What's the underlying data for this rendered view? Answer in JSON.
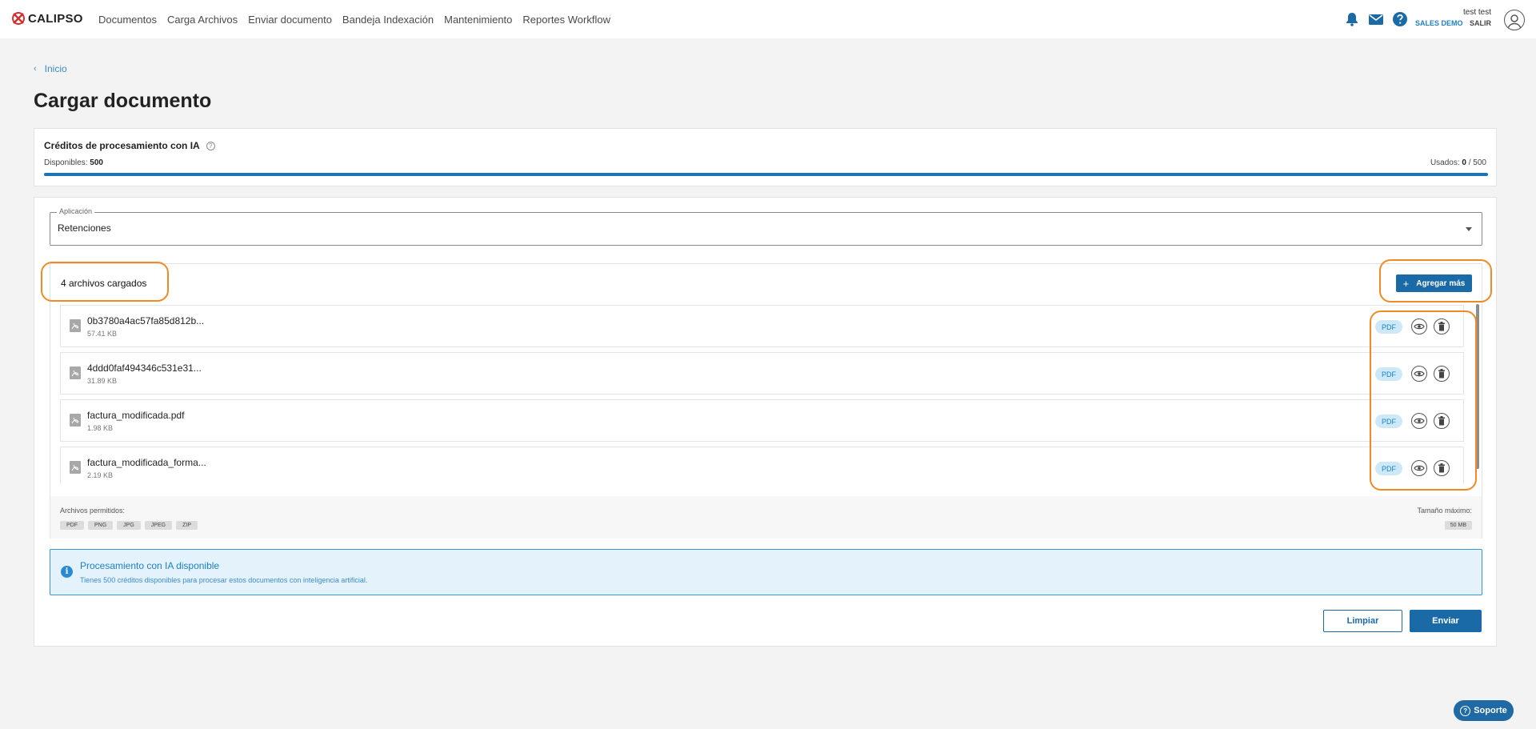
{
  "header": {
    "brand": "CALIPSO",
    "nav": [
      "Documentos",
      "Carga Archivos",
      "Enviar documento",
      "Bandeja Indexación",
      "Mantenimiento",
      "Reportes Workflow"
    ],
    "user_name": "test test",
    "company": "SALES DEMO",
    "logout": "SALIR"
  },
  "breadcrumb": {
    "home": "Inicio"
  },
  "page_title": "Cargar documento",
  "credits": {
    "title": "Créditos de procesamiento con IA",
    "available_label": "Disponibles:",
    "available_value": "500",
    "used_label": "Usados:",
    "used_value": "0",
    "used_total": "/ 500",
    "remaining_fraction": 1.0
  },
  "application": {
    "label": "Aplicación",
    "value": "Retenciones"
  },
  "files": {
    "count_label": "4 archivos cargados",
    "add_more": "Agregar más",
    "items": [
      {
        "name": "0b3780a4ac57fa85d812b...",
        "size": "57.41 KB",
        "type": "PDF"
      },
      {
        "name": "4ddd0faf494346c531e31...",
        "size": "31.89 KB",
        "type": "PDF"
      },
      {
        "name": "factura_modificada.pdf",
        "size": "1.98 KB",
        "type": "PDF"
      },
      {
        "name": "factura_modificada_forma...",
        "size": "2.19 KB",
        "type": "PDF"
      }
    ],
    "allowed_label": "Archivos permitidos:",
    "allowed_types": [
      "PDF",
      "PNG",
      "JPG",
      "JPEG",
      "ZIP"
    ],
    "max_size_label": "Tamaño máximo:",
    "max_size": "50 MB"
  },
  "info": {
    "title": "Procesamiento con IA disponible",
    "text": "Tienes 500 créditos disponibles para procesar estos documentos con inteligencia artificial."
  },
  "actions": {
    "clear": "Limpiar",
    "send": "Enviar"
  },
  "support": "Soporte",
  "colors": {
    "primary": "#1b6aa8",
    "highlight": "#f08a24",
    "info_bg": "#e4f2fc",
    "badge_bg": "#cde9f8"
  }
}
